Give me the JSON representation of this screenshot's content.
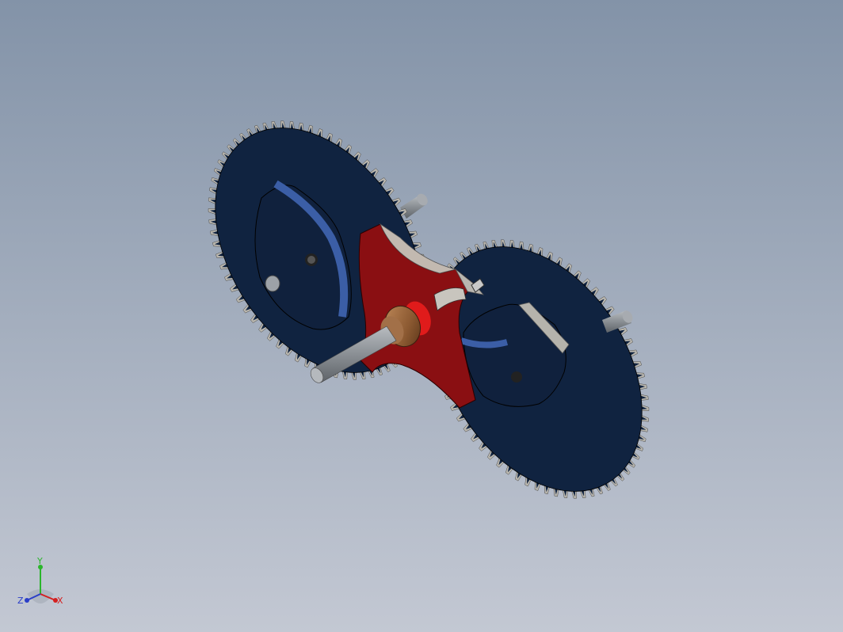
{
  "viewport": {
    "background_top": "#8393a8",
    "background_bottom": "#c3c8d3"
  },
  "model": {
    "parts": [
      {
        "name": "gear-left",
        "color": "#102340"
      },
      {
        "name": "gear-right",
        "color": "#102340"
      },
      {
        "name": "cam-plate-left",
        "color": "#102340",
        "edge_color": "#3b5ea6"
      },
      {
        "name": "cam-plate-right",
        "color": "#102340",
        "edge_color": "#3b5ea6"
      },
      {
        "name": "cross-link",
        "color": "#8a0f12"
      },
      {
        "name": "bushing",
        "color": "#8c5a32"
      },
      {
        "name": "shaft",
        "color": "#8a8f94"
      }
    ]
  },
  "triad": {
    "x_label": "X",
    "y_label": "Y",
    "z_label": "Z",
    "x_color": "#d42020",
    "y_color": "#2bb52b",
    "z_color": "#2a3ec8"
  }
}
